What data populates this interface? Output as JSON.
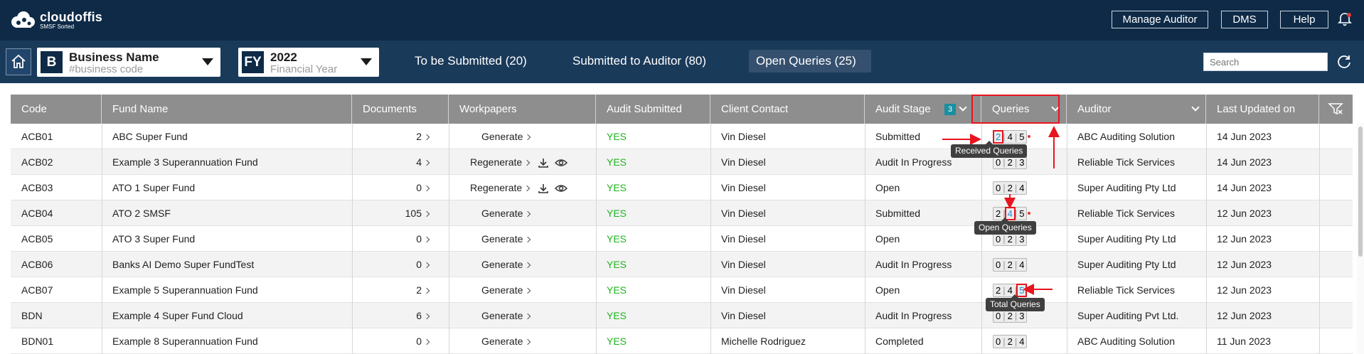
{
  "brand": {
    "name": "cloudoffis",
    "tagline": "SMSF Sorted"
  },
  "top_buttons": [
    "Manage Auditor",
    "DMS",
    "Help"
  ],
  "business_selector": {
    "badge": "B",
    "title": "Business Name",
    "subtitle": "#business code"
  },
  "year_selector": {
    "badge": "FY",
    "title": "2022",
    "subtitle": "Financial Year"
  },
  "tabs": [
    {
      "label": "To be Submitted (20)"
    },
    {
      "label": "Submitted to Auditor (80)"
    },
    {
      "label": "Open Queries (25)"
    }
  ],
  "search": {
    "placeholder": "Search"
  },
  "columns": [
    "Code",
    "Fund Name",
    "Documents",
    "Workpapers",
    "Audit Submitted",
    "Client Contact",
    "Audit Stage",
    "Queries",
    "Auditor",
    "Last Updated on"
  ],
  "audit_stage_badge": "3",
  "rows": [
    {
      "code": "ACB01",
      "fund": "ABC Super Fund",
      "docs": "2",
      "workpaper": "Generate",
      "wp_icons": false,
      "submitted": "YES",
      "contact": "Vin Diesel",
      "stage": "Submitted",
      "q": [
        "2",
        "4",
        "5"
      ],
      "dot": true,
      "auditor": "ABC Auditing Solution",
      "updated": "14 Jun 2023"
    },
    {
      "code": "ACB02",
      "fund": "Example 3 Superannuation Fund",
      "docs": "4",
      "workpaper": "Regenerate",
      "wp_icons": true,
      "submitted": "YES",
      "contact": "Vin Diesel",
      "stage": "Audit In Progress",
      "q": [
        "0",
        "2",
        "3"
      ],
      "dot": false,
      "auditor": "Reliable Tick Services",
      "updated": "14 Jun 2023"
    },
    {
      "code": "ACB03",
      "fund": "ATO 1 Super Fund",
      "docs": "0",
      "workpaper": "Regenerate",
      "wp_icons": true,
      "submitted": "YES",
      "contact": "Vin Diesel",
      "stage": "Open",
      "q": [
        "0",
        "2",
        "4"
      ],
      "dot": false,
      "auditor": "Super Auditing Pty Ltd",
      "updated": "14 Jun 2023"
    },
    {
      "code": "ACB04",
      "fund": "ATO 2 SMSF",
      "docs": "105",
      "workpaper": "Generate",
      "wp_icons": false,
      "submitted": "YES",
      "contact": "Vin Diesel",
      "stage": "Submitted",
      "q": [
        "2",
        "4",
        "5"
      ],
      "dot": true,
      "auditor": "Reliable Tick Services",
      "updated": "12 Jun 2023"
    },
    {
      "code": "ACB05",
      "fund": "ATO 3 Super Fund",
      "docs": "0",
      "workpaper": "Generate",
      "wp_icons": false,
      "submitted": "YES",
      "contact": "Vin Diesel",
      "stage": "Open",
      "q": [
        "0",
        "2",
        "3"
      ],
      "dot": false,
      "auditor": "Super Auditing Pty Ltd",
      "updated": "12 Jun 2023"
    },
    {
      "code": "ACB06",
      "fund": "Banks AI Demo Super FundTest",
      "docs": "0",
      "workpaper": "Generate",
      "wp_icons": false,
      "submitted": "YES",
      "contact": "Vin Diesel",
      "stage": "Audit In Progress",
      "q": [
        "0",
        "2",
        "4"
      ],
      "dot": false,
      "auditor": "Super Auditing Pty Ltd",
      "updated": "12 Jun 2023"
    },
    {
      "code": "ACB07",
      "fund": "Example 5 Superannuation Fund",
      "docs": "2",
      "workpaper": "Generate",
      "wp_icons": false,
      "submitted": "YES",
      "contact": "Vin Diesel",
      "stage": "Open",
      "q": [
        "2",
        "4",
        "5"
      ],
      "dot": false,
      "auditor": "Reliable Tick Services",
      "updated": "12 Jun 2023"
    },
    {
      "code": "BDN",
      "fund": "Example 4 Super Fund Cloud",
      "docs": "6",
      "workpaper": "Generate",
      "wp_icons": false,
      "submitted": "YES",
      "contact": "Vin Diesel",
      "stage": "Audit In Progress",
      "q": [
        "0",
        "2",
        "3"
      ],
      "dot": false,
      "auditor": "Super Auditing Pvt Ltd.",
      "updated": "12 Jun 2023"
    },
    {
      "code": "BDN01",
      "fund": "Example 8 Superannuation Fund",
      "docs": "0",
      "workpaper": "Generate",
      "wp_icons": false,
      "submitted": "YES",
      "contact": "Michelle Rodriguez",
      "stage": "Completed",
      "q": [
        "0",
        "2",
        "4"
      ],
      "dot": false,
      "auditor": "ABC Auditing Solution",
      "updated": "11 Jun 2023"
    }
  ],
  "tooltips": {
    "received": "Received Queries",
    "open": "Open Queries",
    "total": "Total Queries"
  },
  "colors": {
    "header_bg": "#0e2a47",
    "nav_bg": "#1a3a5a",
    "yes": "#1cb51c",
    "highlight": "#e8141e",
    "query_blue": "#1a8fd6"
  }
}
